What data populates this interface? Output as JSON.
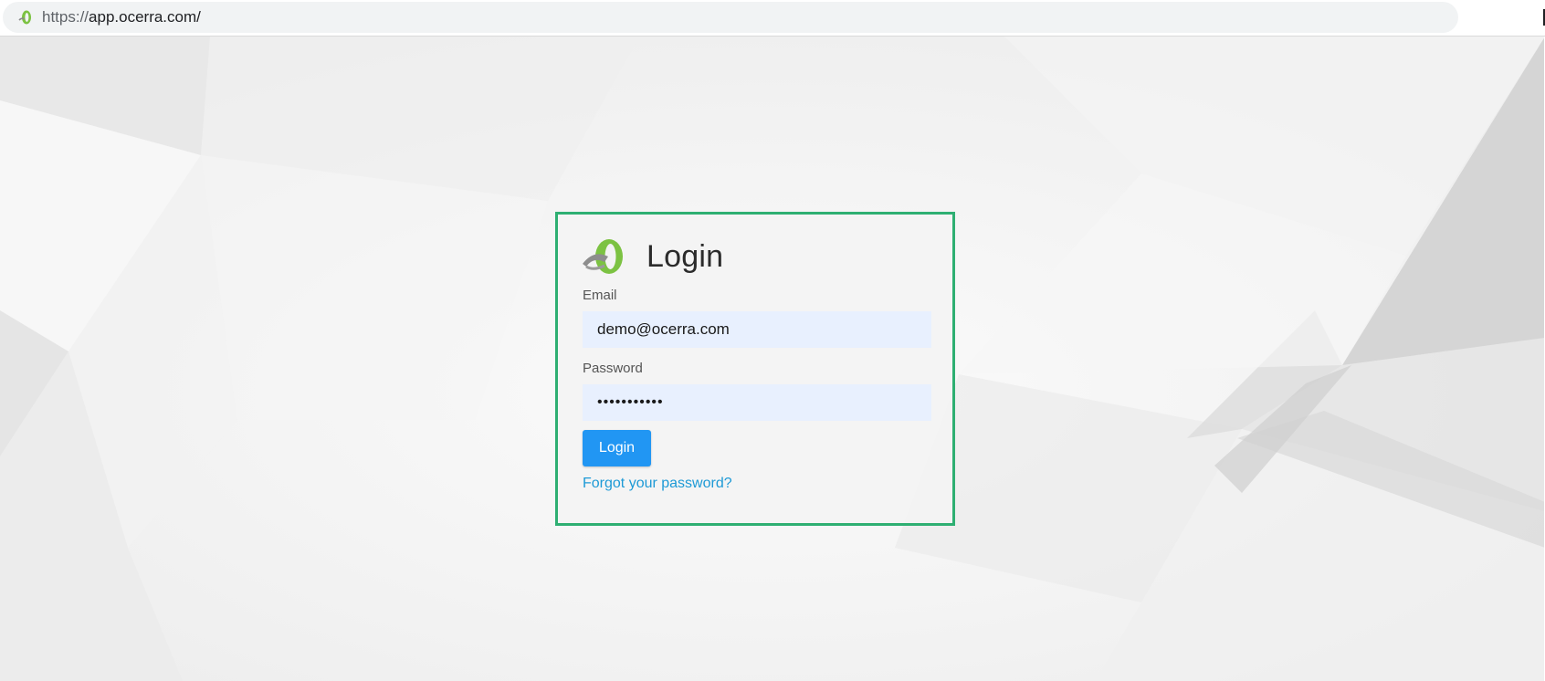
{
  "browser": {
    "url_scheme": "https://",
    "url_rest": "app.ocerra.com/",
    "favicon": "ocerra-logo-icon"
  },
  "login": {
    "title": "Login",
    "email_label": "Email",
    "email_value": "demo@ocerra.com",
    "password_label": "Password",
    "password_value": "•••••••••••",
    "button_label": "Login",
    "forgot_link": "Forgot your password?"
  },
  "colors": {
    "card_border": "#2eaf72",
    "button": "#2196f3",
    "link": "#1e9ad6",
    "input_bg": "#e8f0fe",
    "logo_green": "#7cc242"
  }
}
